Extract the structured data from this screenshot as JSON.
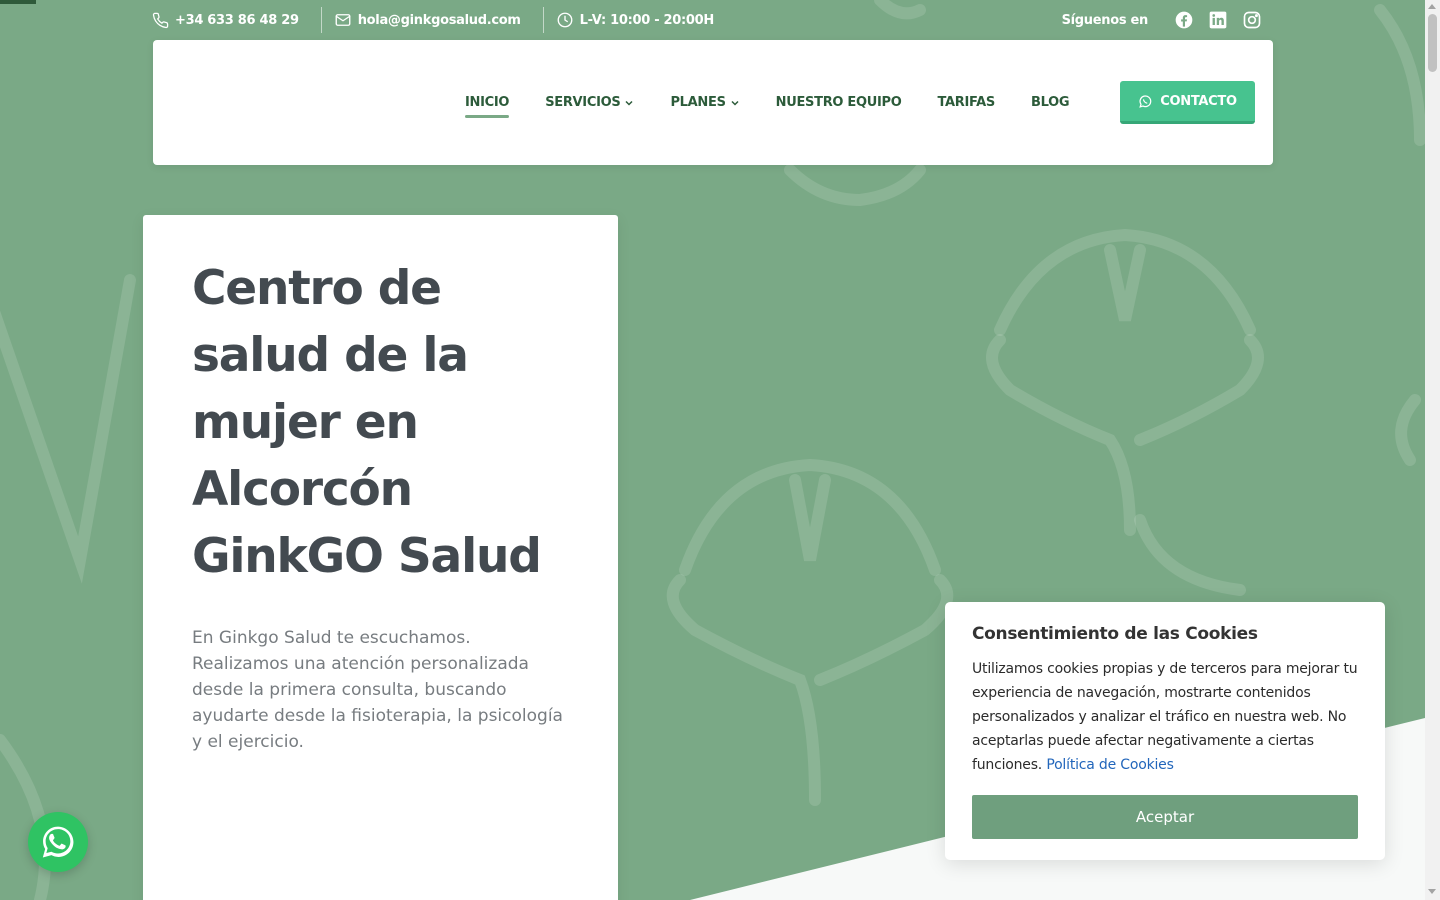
{
  "topbar": {
    "phone": "+34 633 86 48 29",
    "email": "hola@ginkgosalud.com",
    "hours": "L-V: 10:00 - 20:00H",
    "social_label": "Síguenos en"
  },
  "nav": {
    "items": [
      {
        "label": "INICIO",
        "active": true,
        "dropdown": false
      },
      {
        "label": "SERVICIOS",
        "active": false,
        "dropdown": true
      },
      {
        "label": "PLANES",
        "active": false,
        "dropdown": true
      },
      {
        "label": "NUESTRO EQUIPO",
        "active": false,
        "dropdown": false
      },
      {
        "label": "TARIFAS",
        "active": false,
        "dropdown": false
      },
      {
        "label": "BLOG",
        "active": false,
        "dropdown": false
      }
    ],
    "contact_label": "CONTACTO"
  },
  "hero": {
    "title": "Centro de salud de la mujer en Alcorcón GinkGO Salud",
    "text": "En Ginkgo Salud te escuchamos. Realizamos una atención personalizada desde la primera consulta, buscando ayudarte desde la fisioterapia, la psicología y el ejercicio."
  },
  "cookie": {
    "title": "Consentimiento de las Cookies",
    "text": "Utilizamos cookies propias y de terceros para mejorar tu experiencia de navegación, mostrarte contenidos personalizados y analizar el tráfico en nuestra web. No aceptarlas puede afectar negativamente a ciertas funciones.",
    "link_label": "Política de Cookies",
    "accept_label": "Aceptar"
  },
  "colors": {
    "background": "#7aa986",
    "nav_text": "#2c5b3a",
    "contact_button": "#47c38f",
    "accept_button": "#6f9f7e",
    "whatsapp": "#2fc363"
  },
  "icons": [
    "phone-icon",
    "mail-icon",
    "clock-icon",
    "facebook-icon",
    "linkedin-icon",
    "instagram-icon",
    "chevron-down-icon",
    "whatsapp-icon"
  ]
}
